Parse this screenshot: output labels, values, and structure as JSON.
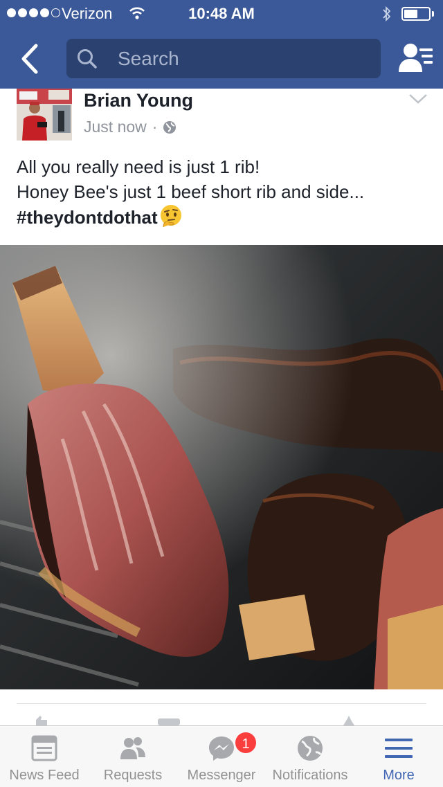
{
  "status_bar": {
    "carrier": "Verizon",
    "time": "10:48 AM",
    "battery_level": 0.55
  },
  "nav": {
    "search_placeholder": "Search"
  },
  "post": {
    "author": "Brian Young",
    "timestamp": "Just now",
    "separator": "·",
    "privacy_icon": "globe-icon",
    "text_lines": [
      "All you really need is just 1 rib!",
      "Honey Bee's just 1 beef short rib and side..."
    ],
    "hashtag": "#theydontdothat",
    "emoji": "thinking-face"
  },
  "tabbar": {
    "tabs": [
      {
        "label": "News Feed",
        "icon": "news-feed-icon",
        "active": false
      },
      {
        "label": "Requests",
        "icon": "friend-requests-icon",
        "active": false
      },
      {
        "label": "Messenger",
        "icon": "messenger-icon",
        "active": false
      },
      {
        "label": "Notifications",
        "icon": "globe-icon",
        "active": false
      },
      {
        "label": "More",
        "icon": "menu-icon",
        "active": true
      }
    ],
    "messenger_badge": "1"
  },
  "colors": {
    "brand": "#3b5998",
    "active_tab": "#4267b2",
    "badge": "#fa3e3e"
  }
}
